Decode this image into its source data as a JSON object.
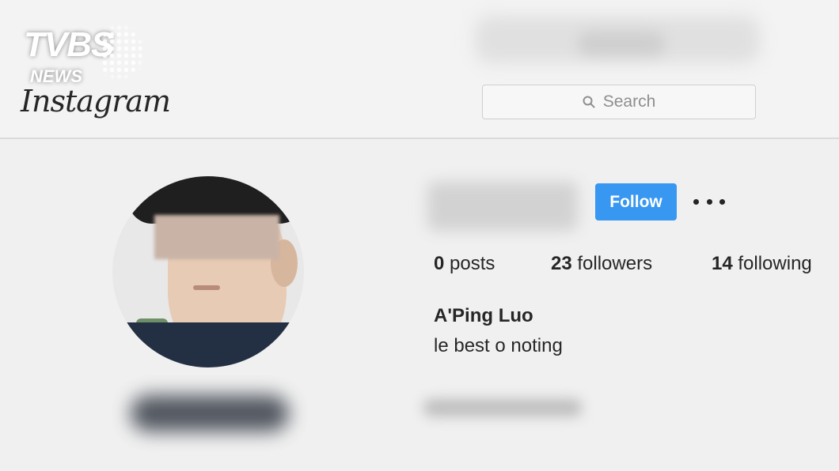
{
  "watermark": {
    "main": "TVBS",
    "sub": "NEWS"
  },
  "header": {
    "logo": "Instagram",
    "search_placeholder": "Search"
  },
  "icons": {
    "search": "search-icon",
    "more": "more-options-icon"
  },
  "profile": {
    "follow_label": "Follow",
    "stats": {
      "posts_count": "0",
      "posts_label": "posts",
      "followers_count": "23",
      "followers_label": "followers",
      "following_count": "14",
      "following_label": "following"
    },
    "full_name": "A'Ping Luo",
    "bio": "le best o noting"
  },
  "colors": {
    "accent": "#3897f0",
    "text": "#262626",
    "muted": "#8e8e8e"
  }
}
